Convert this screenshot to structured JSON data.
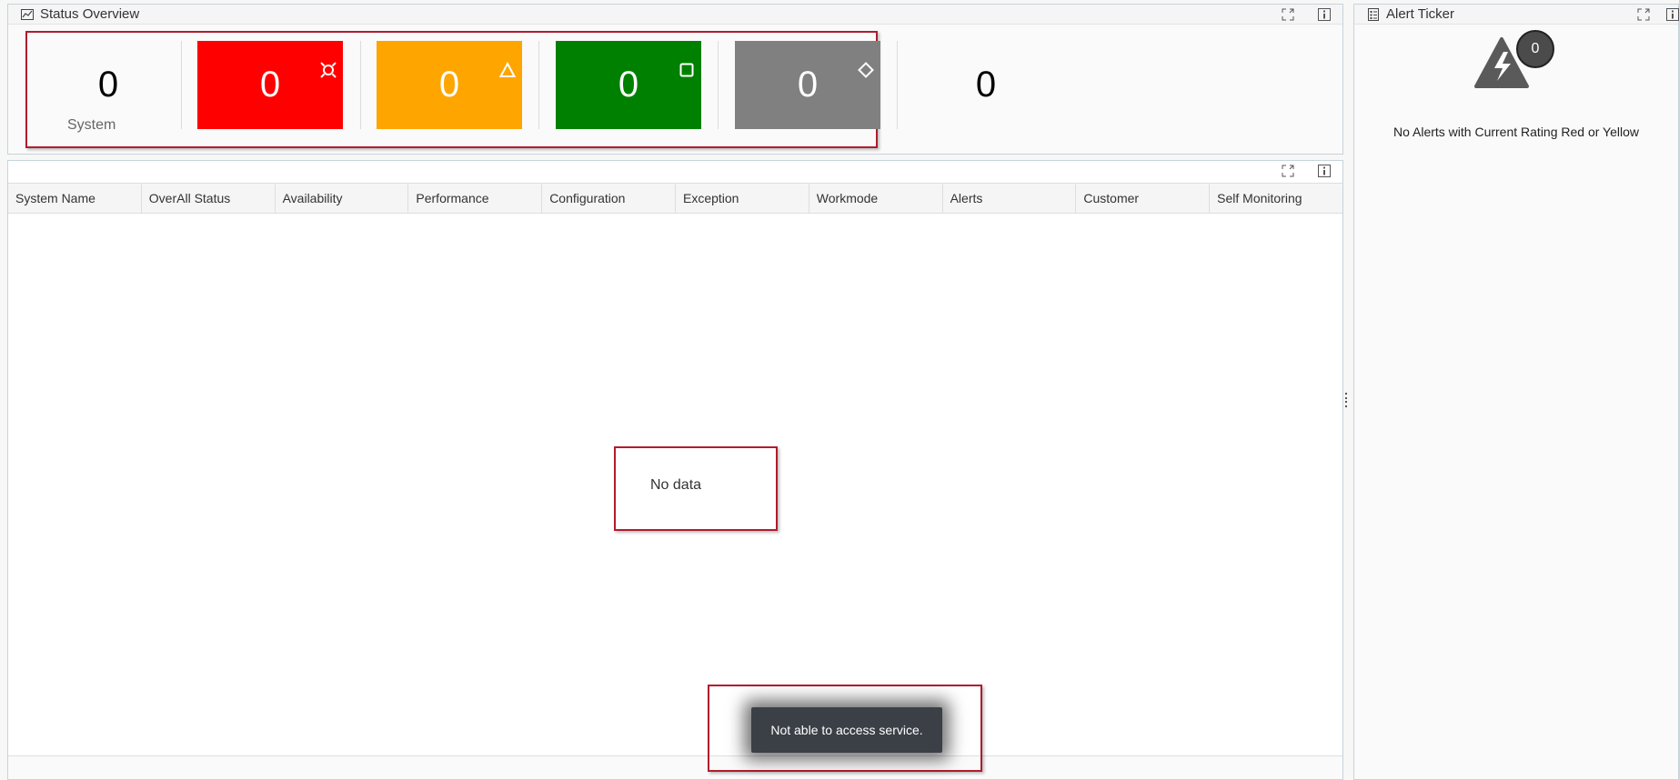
{
  "status_overview": {
    "title": "Status Overview",
    "system_label": "System",
    "tiles": [
      {
        "value": "0",
        "color": "#fafafa",
        "text_color": "#000000",
        "icon": "none"
      },
      {
        "value": "0",
        "color": "#ff0000",
        "text_color": "#ffffff",
        "icon": "critical-icon"
      },
      {
        "value": "0",
        "color": "#ffa500",
        "text_color": "#ffffff",
        "icon": "warning-triangle-icon"
      },
      {
        "value": "0",
        "color": "#008000",
        "text_color": "#ffffff",
        "icon": "square-icon"
      },
      {
        "value": "0",
        "color": "#808080",
        "text_color": "#ffffff",
        "icon": "diamond-icon"
      },
      {
        "value": "0",
        "color": "#fafafa",
        "text_color": "#000000",
        "icon": "none"
      }
    ]
  },
  "table": {
    "columns": [
      "System Name",
      "OverAll Status",
      "Availability",
      "Performance",
      "Configuration",
      "Exception",
      "Workmode",
      "Alerts",
      "Customer",
      "Self Monitoring"
    ],
    "empty_message": "No data"
  },
  "toast": {
    "message": "Not able to access service."
  },
  "alert_ticker": {
    "title": "Alert Ticker",
    "count": "0",
    "message": "No Alerts with Current Rating Red or Yellow"
  },
  "colors": {
    "highlight_frame": "#b01c2e",
    "panel_border": "#c7d3db"
  }
}
